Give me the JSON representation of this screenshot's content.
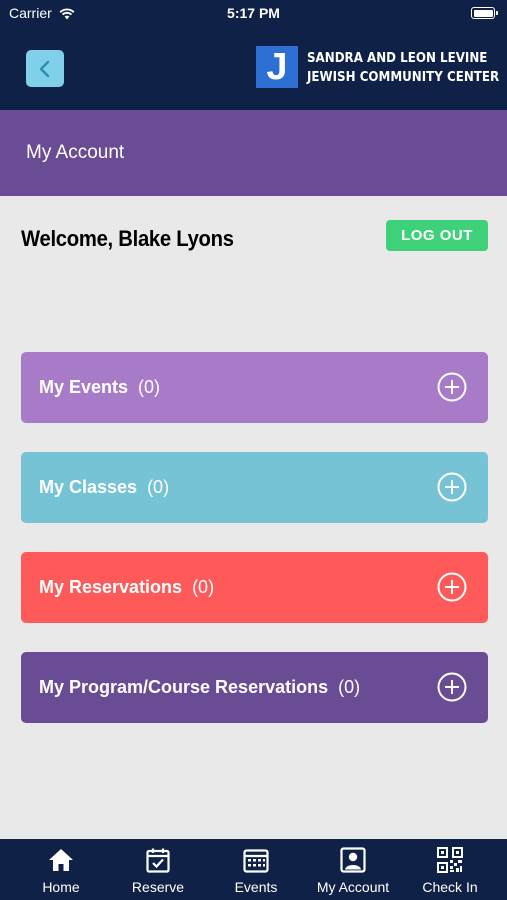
{
  "status_bar": {
    "carrier": "Carrier",
    "time": "5:17 PM",
    "battery_level": 1.0
  },
  "header": {
    "back_icon": "chevron-left-icon",
    "logo_mark": "J",
    "logo_line1": "SANDRA AND LEON LEVINE",
    "logo_line2": "JEWISH COMMUNITY CENTER"
  },
  "page": {
    "title": "My Account"
  },
  "welcome": {
    "text": "Welcome, Blake Lyons",
    "logout_label": "LOG OUT"
  },
  "sections": [
    {
      "title": "My Events",
      "count": "(0)",
      "color": "#a77bc8"
    },
    {
      "title": "My Classes",
      "count": "(0)",
      "color": "#76c3d6"
    },
    {
      "title": "My Reservations",
      "count": "(0)",
      "color": "#fe5a5a"
    },
    {
      "title": "My Program/Course Reservations",
      "count": "(0)",
      "color": "#6a4c94"
    }
  ],
  "tabs": [
    {
      "label": "Home",
      "icon": "home-icon"
    },
    {
      "label": "Reserve",
      "icon": "calendar-check-icon"
    },
    {
      "label": "Events",
      "icon": "calendar-grid-icon"
    },
    {
      "label": "My Account",
      "icon": "account-icon"
    },
    {
      "label": "Check In",
      "icon": "qr-code-icon"
    }
  ],
  "colors": {
    "navy": "#0f2147",
    "purple": "#6a4c94",
    "green": "#3fd17a",
    "back_button": "#7fd0e8",
    "logo_blue": "#2e6fd3",
    "background": "#e9e9e9"
  }
}
